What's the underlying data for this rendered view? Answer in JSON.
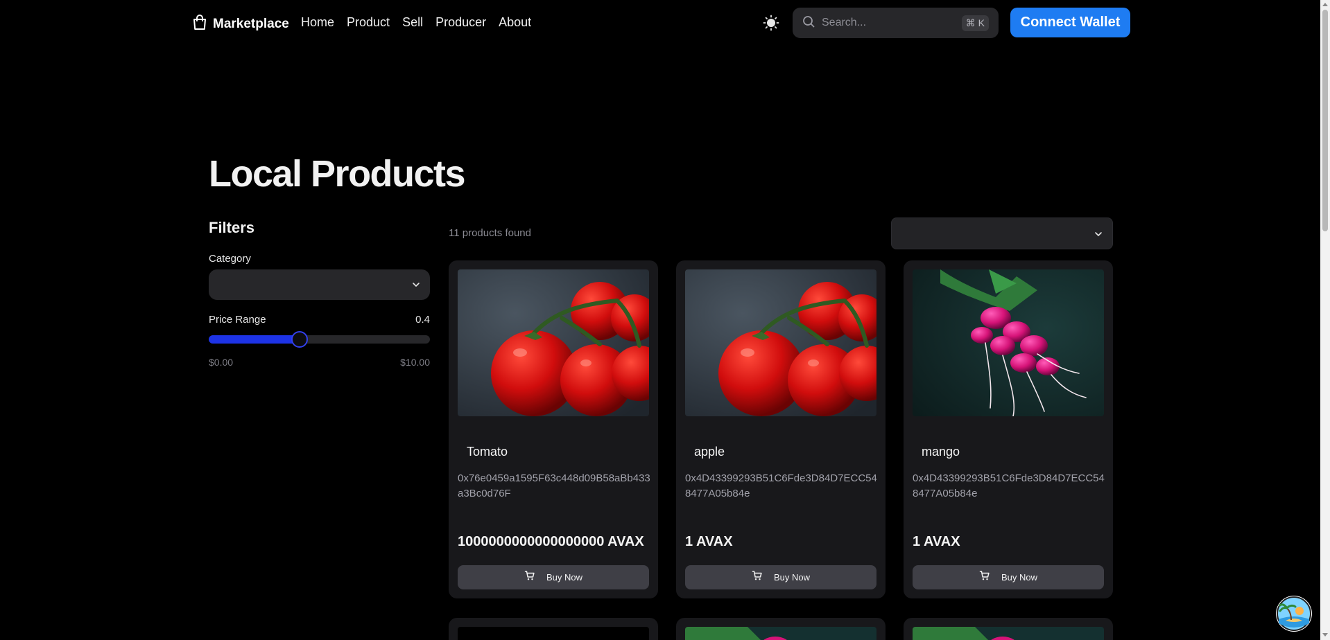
{
  "nav": {
    "brand": "Marketplace",
    "links": [
      "Home",
      "Product",
      "Sell",
      "Producer",
      "About"
    ],
    "search_placeholder": "Search...",
    "search_shortcut": "⌘ K",
    "connect_label": "Connect Wallet"
  },
  "page": {
    "title": "Local Products"
  },
  "filters": {
    "title": "Filters",
    "category_label": "Category",
    "price_label": "Price Range",
    "price_value": "0.4",
    "price_fraction": 0.41,
    "min_label": "$0.00",
    "max_label": "$10.00"
  },
  "results": {
    "count_text": "11 products found"
  },
  "products": [
    {
      "name": "Tomato",
      "address": "0x76e0459a1595F63c448d09B58aBb433a3Bc0d76F",
      "price": "1000000000000000000 AVAX",
      "buy_label": "Buy Now",
      "image": "tomato"
    },
    {
      "name": "apple",
      "address": "0x4D43399293B51C6Fde3D84D7ECC548477A05b84e",
      "price": "1 AVAX",
      "buy_label": "Buy Now",
      "image": "tomato"
    },
    {
      "name": "mango",
      "address": "0x4D43399293B51C6Fde3D84D7ECC548477A05b84e",
      "price": "1 AVAX",
      "buy_label": "Buy Now",
      "image": "radish"
    }
  ],
  "colors": {
    "accent": "#1e7cf2",
    "slider": "#1d33e6",
    "card": "#18181b",
    "button": "#3f3f46"
  }
}
